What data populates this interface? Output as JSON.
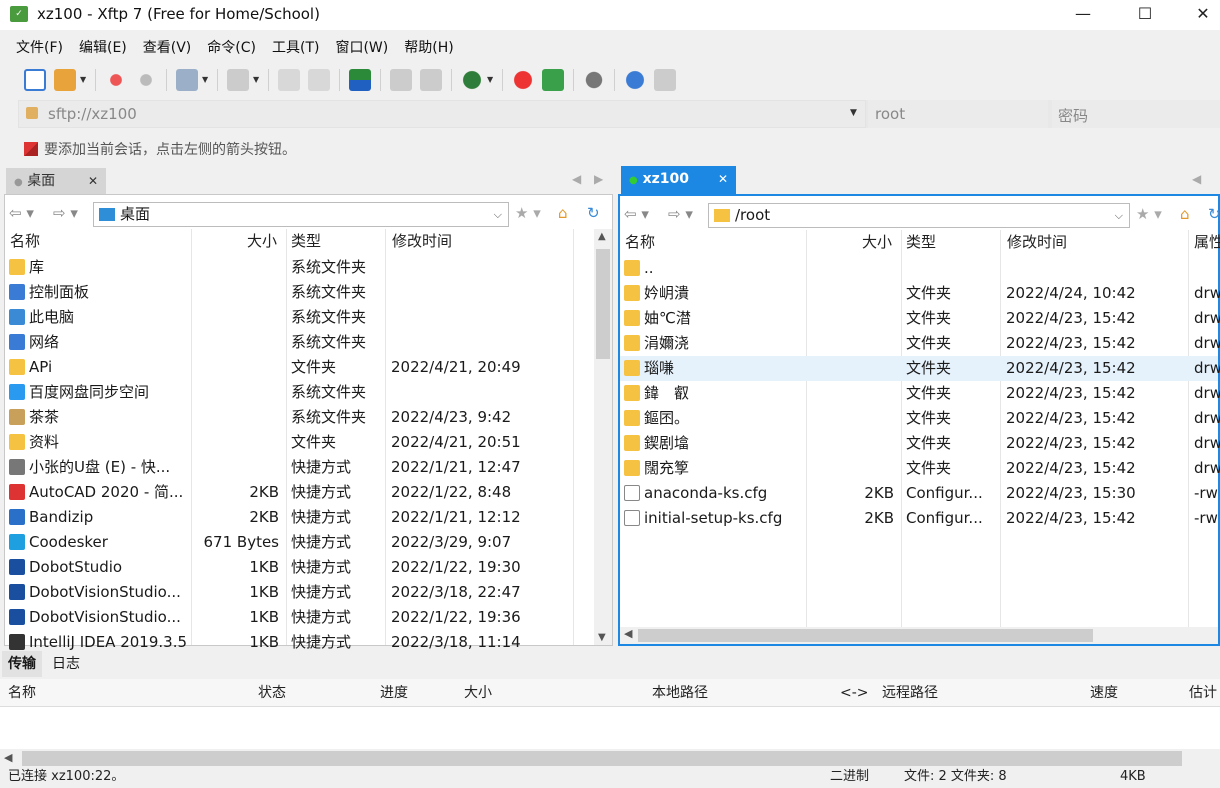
{
  "window": {
    "title": "xz100 - Xftp 7 (Free for Home/School)",
    "app_icon": "xftp-icon",
    "minimize": "—",
    "maximize": "☐",
    "close": "✕"
  },
  "menu": [
    "文件(F)",
    "编辑(E)",
    "查看(V)",
    "命令(C)",
    "工具(T)",
    "窗口(W)",
    "帮助(H)"
  ],
  "address": {
    "host": "sftp://xz100",
    "user": "root",
    "password_placeholder": "密码"
  },
  "hint": "要添加当前会话，点击左侧的箭头按钮。",
  "left": {
    "tab": "桌面",
    "path": "桌面",
    "columns": [
      "名称",
      "大小",
      "类型",
      "修改时间"
    ],
    "rows": [
      {
        "name": "库",
        "size": "",
        "type": "系统文件夹",
        "mtime": "",
        "icon": "library-icon"
      },
      {
        "name": "控制面板",
        "size": "",
        "type": "系统文件夹",
        "mtime": "",
        "icon": "control-panel-icon"
      },
      {
        "name": "此电脑",
        "size": "",
        "type": "系统文件夹",
        "mtime": "",
        "icon": "computer-icon"
      },
      {
        "name": "网络",
        "size": "",
        "type": "系统文件夹",
        "mtime": "",
        "icon": "network-icon"
      },
      {
        "name": "APi",
        "size": "",
        "type": "文件夹",
        "mtime": "2022/4/21, 20:49",
        "icon": "folder-icon"
      },
      {
        "name": "百度网盘同步空间",
        "size": "",
        "type": "系统文件夹",
        "mtime": "",
        "icon": "baidu-netdisk-icon"
      },
      {
        "name": "茶茶",
        "size": "",
        "type": "系统文件夹",
        "mtime": "2022/4/23, 9:42",
        "icon": "user-folder-icon"
      },
      {
        "name": "资料",
        "size": "",
        "type": "文件夹",
        "mtime": "2022/4/21, 20:51",
        "icon": "folder-icon"
      },
      {
        "name": "小张的U盘 (E) - 快...",
        "size": "",
        "type": "快捷方式",
        "mtime": "2022/1/21, 12:47",
        "icon": "usb-shortcut-icon"
      },
      {
        "name": "AutoCAD 2020 - 简...",
        "size": "2KB",
        "type": "快捷方式",
        "mtime": "2022/1/22, 8:48",
        "icon": "autocad-icon"
      },
      {
        "name": "Bandizip",
        "size": "2KB",
        "type": "快捷方式",
        "mtime": "2022/1/21, 12:12",
        "icon": "bandizip-icon"
      },
      {
        "name": "Coodesker",
        "size": "671 Bytes",
        "type": "快捷方式",
        "mtime": "2022/3/29, 9:07",
        "icon": "coodesker-icon"
      },
      {
        "name": "DobotStudio",
        "size": "1KB",
        "type": "快捷方式",
        "mtime": "2022/1/22, 19:30",
        "icon": "dobot-icon"
      },
      {
        "name": "DobotVisionStudio...",
        "size": "1KB",
        "type": "快捷方式",
        "mtime": "2022/3/18, 22:47",
        "icon": "dobot-icon"
      },
      {
        "name": "DobotVisionStudio...",
        "size": "1KB",
        "type": "快捷方式",
        "mtime": "2022/1/22, 19:36",
        "icon": "dobot-icon"
      },
      {
        "name": "IntelliJ IDEA 2019.3.5",
        "size": "1KB",
        "type": "快捷方式",
        "mtime": "2022/3/18, 11:14",
        "icon": "intellij-icon"
      }
    ]
  },
  "right": {
    "tab": "xz100",
    "path": "/root",
    "columns": [
      "名称",
      "大小",
      "类型",
      "修改时间",
      "属性"
    ],
    "rows": [
      {
        "name": "..",
        "size": "",
        "type": "",
        "mtime": "",
        "attr": "",
        "icon": "folder-icon"
      },
      {
        "name": "妗岄潰",
        "size": "",
        "type": "文件夹",
        "mtime": "2022/4/24, 10:42",
        "attr": "drw",
        "icon": "folder-icon"
      },
      {
        "name": "妯℃澘",
        "size": "",
        "type": "文件夹",
        "mtime": "2022/4/23, 15:42",
        "attr": "drw",
        "icon": "folder-icon"
      },
      {
        "name": "涓嬭浇",
        "size": "",
        "type": "文件夹",
        "mtime": "2022/4/23, 15:42",
        "attr": "drw",
        "icon": "folder-icon"
      },
      {
        "name": "瑙嗛",
        "size": "",
        "type": "文件夹",
        "mtime": "2022/4/23, 15:42",
        "attr": "drw",
        "icon": "folder-icon"
      },
      {
        "name": "鍏　叡",
        "size": "",
        "type": "文件夹",
        "mtime": "2022/4/23, 15:42",
        "attr": "drw",
        "icon": "folder-icon"
      },
      {
        "name": "鏂囨。",
        "size": "",
        "type": "文件夹",
        "mtime": "2022/4/23, 15:42",
        "attr": "drw",
        "icon": "folder-icon"
      },
      {
        "name": "鍥剧墖",
        "size": "",
        "type": "文件夹",
        "mtime": "2022/4/23, 15:42",
        "attr": "drw",
        "icon": "folder-icon"
      },
      {
        "name": "闊充箰",
        "size": "",
        "type": "文件夹",
        "mtime": "2022/4/23, 15:42",
        "attr": "drw",
        "icon": "folder-icon"
      },
      {
        "name": "anaconda-ks.cfg",
        "size": "2KB",
        "type": "Configur...",
        "mtime": "2022/4/23, 15:30",
        "attr": "-rw",
        "icon": "config-file-icon"
      },
      {
        "name": "initial-setup-ks.cfg",
        "size": "2KB",
        "type": "Configur...",
        "mtime": "2022/4/23, 15:42",
        "attr": "-rw",
        "icon": "config-file-icon"
      }
    ]
  },
  "bottom_tabs": [
    "传输",
    "日志"
  ],
  "transfer_columns": [
    "名称",
    "状态",
    "进度",
    "大小",
    "本地路径",
    "<->",
    "远程路径",
    "速度",
    "估计"
  ],
  "status": {
    "connection": "已连接 xz100:22。",
    "mode": "二进制",
    "counts": "文件: 2  文件夹: 8",
    "total": "4KB"
  },
  "colors": {
    "accent": "#1c88e3",
    "folder": "#f5c242",
    "selected_row": "#e5f1fb"
  }
}
